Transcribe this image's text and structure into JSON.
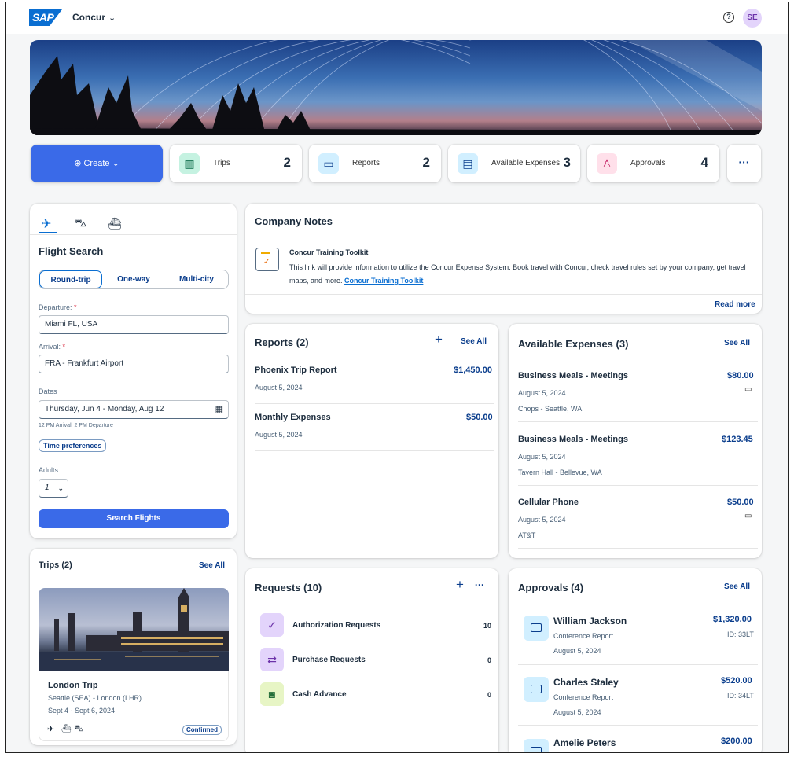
{
  "header": {
    "logo": "SAP",
    "app_name": "Concur",
    "app_chevron": "⌄",
    "help_icon": "question-circle-icon",
    "avatar_initials": "SE"
  },
  "tiles": {
    "create_label": "⊕ Create ⌄",
    "trips": {
      "label": "Trips",
      "count": "2"
    },
    "reports": {
      "label": "Reports",
      "count": "2"
    },
    "expenses": {
      "label": "Available Expenses",
      "count": "3"
    },
    "approvals": {
      "label": "Approvals",
      "count": "4"
    },
    "more": "···"
  },
  "flight_search": {
    "tabs": [
      "flight-icon",
      "car-icon",
      "hotel-icon"
    ],
    "title": "Flight Search",
    "trip_types": [
      "Round-trip",
      "One-way",
      "Multi-city"
    ],
    "departure_label": "Departure:",
    "departure_value": "Miami FL, USA",
    "arrival_label": "Arrival:",
    "arrival_value": "FRA - Frankfurt Airport",
    "dates_label": "Dates",
    "dates_value": "Thursday, Jun 4 - Monday, Aug 12",
    "dates_hint": "12 PM Arrival, 2 PM Departure",
    "time_pref": "Time preferences",
    "adults_label": "Adults",
    "adults_value": "1",
    "search_button": "Search Flights",
    "required_mark": "*"
  },
  "trips_card": {
    "title": "Trips (2)",
    "see_all": "See All",
    "trip_name": "London Trip",
    "route": "Seattle (SEA) - London (LHR)",
    "dates": "Sept 4 - Sept 6, 2024",
    "status": "Confirmed"
  },
  "company_notes": {
    "title": "Company Notes",
    "note_title": "Concur Training Toolkit",
    "note_text": "This link will provide information to utilize the Concur Expense System. Book travel with Concur, check travel rules set by your company, get travel maps, and more.",
    "note_link": "Concur Training Toolkit",
    "read_more": "Read more"
  },
  "reports_card": {
    "title": "Reports (2)",
    "add": "+",
    "see_all": "See All",
    "items": [
      {
        "name": "Phoenix Trip Report",
        "amount": "$1,450.00",
        "date": "August 5, 2024"
      },
      {
        "name": "Monthly Expenses",
        "amount": "$50.00",
        "date": "August 5, 2024"
      }
    ]
  },
  "expenses_card": {
    "title": "Available Expenses (3)",
    "see_all": "See All",
    "items": [
      {
        "name": "Business Meals - Meetings",
        "amount": "$80.00",
        "date": "August 5, 2024",
        "detail": "Chops - Seattle, WA"
      },
      {
        "name": "Business Meals - Meetings",
        "amount": "$123.45",
        "date": "August 5, 2024",
        "detail": "Tavern Hall - Bellevue, WA"
      },
      {
        "name": "Cellular Phone",
        "amount": "$50.00",
        "date": "August 5, 2024",
        "detail": "AT&T"
      }
    ]
  },
  "requests_card": {
    "title": "Requests (10)",
    "add": "+",
    "more": "···",
    "items": [
      {
        "name": "Authorization Requests",
        "count": "10"
      },
      {
        "name": "Purchase Requests",
        "count": "0"
      },
      {
        "name": "Cash Advance",
        "count": "0"
      }
    ]
  },
  "approvals_card": {
    "title": "Approvals (4)",
    "see_all": "See All",
    "items": [
      {
        "name": "William Jackson",
        "type": "Conference Report",
        "date": "August 5, 2024",
        "amount": "$1,320.00",
        "id": "ID: 33LT"
      },
      {
        "name": "Charles Staley",
        "type": "Conference Report",
        "date": "August 5, 2024",
        "amount": "$520.00",
        "id": "ID: 34LT"
      },
      {
        "name": "Amelie Peters",
        "amount": "$200.00"
      }
    ]
  },
  "colors": {
    "brand": "#3a6ae8",
    "link": "#0a3d8c",
    "required": "#d2001a"
  }
}
